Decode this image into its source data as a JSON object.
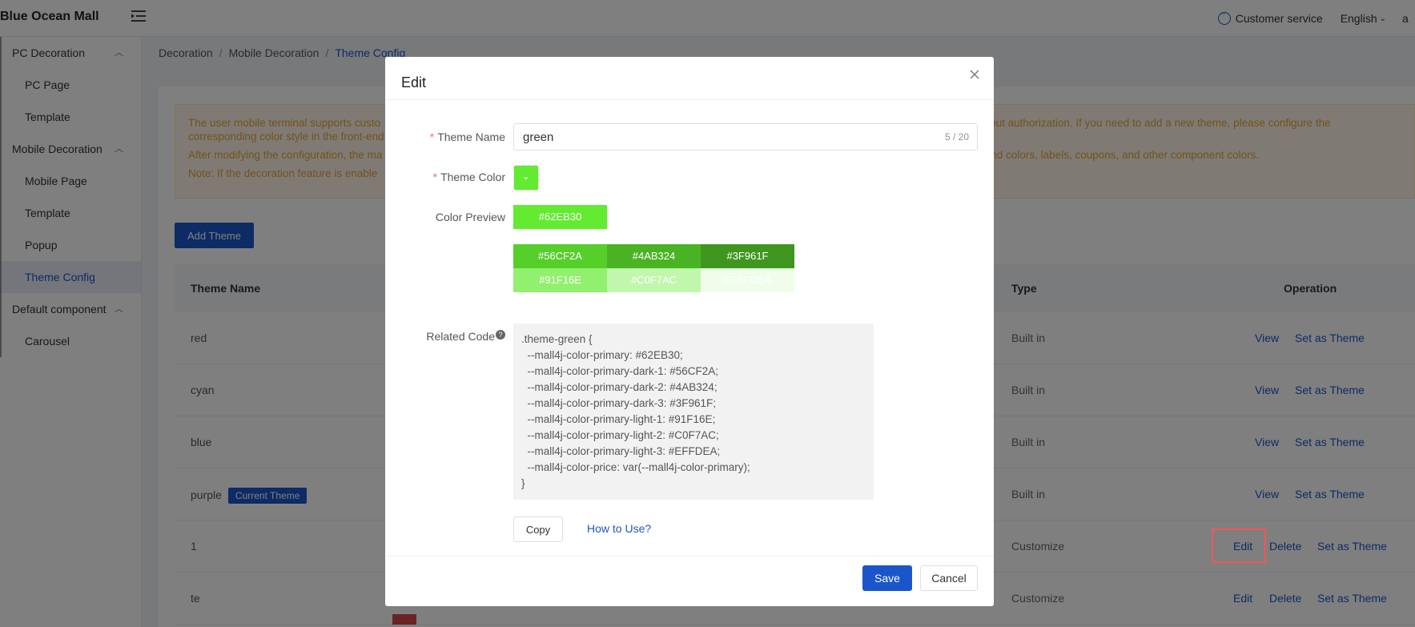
{
  "header": {
    "brand": "Blue Ocean Mall",
    "customer_service": "Customer service",
    "language": "English",
    "user_initial": "a"
  },
  "sidebar": {
    "groups": [
      {
        "label": "PC Decoration",
        "items": [
          {
            "label": "PC Page"
          },
          {
            "label": "Template"
          }
        ]
      },
      {
        "label": "Mobile Decoration",
        "items": [
          {
            "label": "Mobile Page"
          },
          {
            "label": "Template"
          },
          {
            "label": "Popup"
          },
          {
            "label": "Theme Config"
          }
        ]
      },
      {
        "label": "Default component",
        "items": [
          {
            "label": "Carousel"
          }
        ]
      }
    ]
  },
  "breadcrumb": [
    "Decoration",
    "Mobile Decoration",
    "Theme Config"
  ],
  "notice": {
    "line1a": "The user mobile terminal supports custo",
    "line1b": "out authorization. If you need to add a new theme, please configure the",
    "line2": "corresponding color style in the front-end",
    "line3a": "After modifying the configuration, the ma",
    "line3b": "nd colors, labels, coupons, and other component colors.",
    "line4": "Note: If the decoration feature is enable"
  },
  "add_theme_label": "Add Theme",
  "table": {
    "headers": {
      "name": "Theme Name",
      "type": "Type",
      "operation": "Operation"
    },
    "rows": [
      {
        "name": "red",
        "type": "Built in",
        "ops": [
          "View",
          "Set as Theme"
        ]
      },
      {
        "name": "cyan",
        "type": "Built in",
        "ops": [
          "View",
          "Set as Theme"
        ]
      },
      {
        "name": "blue",
        "type": "Built in",
        "ops": [
          "View",
          "Set as Theme"
        ]
      },
      {
        "name": "purple",
        "badge": "Current Theme",
        "type": "Built in",
        "ops": [
          "View",
          "Set as Theme"
        ]
      },
      {
        "name": "1",
        "type": "Customize",
        "ops": [
          "Edit",
          "Delete",
          "Set as Theme"
        ]
      },
      {
        "name": "te",
        "type": "Customize",
        "ops": [
          "Edit",
          "Delete",
          "Set as Theme"
        ]
      }
    ]
  },
  "modal": {
    "title": "Edit",
    "theme_name_label": "Theme Name",
    "theme_name_value": "green",
    "theme_name_count": "5 / 20",
    "theme_color_label": "Theme Color",
    "theme_color": "#62EB30",
    "color_preview_label": "Color Preview",
    "preview_main": "#62EB30",
    "palette": [
      {
        "label": "#56CF2A",
        "color": "#56CF2A"
      },
      {
        "label": "#4AB324",
        "color": "#4AB324"
      },
      {
        "label": "#3F961F",
        "color": "#3F961F"
      },
      {
        "label": "#91F16E",
        "color": "#91F16E"
      },
      {
        "label": "#C0F7AC",
        "color": "#C0F7AC"
      },
      {
        "label": "#EFFDEA",
        "color": "#EFFDEA"
      }
    ],
    "related_code_label": "Related Code",
    "code_lines": [
      ".theme-green {",
      "  --mall4j-color-primary: #62EB30;",
      "  --mall4j-color-primary-dark-1: #56CF2A;",
      "  --mall4j-color-primary-dark-2: #4AB324;",
      "  --mall4j-color-primary-dark-3: #3F961F;",
      "  --mall4j-color-primary-light-1: #91F16E;",
      "  --mall4j-color-primary-light-2: #C0F7AC;",
      "  --mall4j-color-primary-light-3: #EFFDEA;",
      "  --mall4j-color-price: var(--mall4j-color-primary);",
      "}"
    ],
    "copy_label": "Copy",
    "how_to_label": "How to Use?",
    "save_label": "Save",
    "cancel_label": "Cancel"
  },
  "colors": {
    "accent": "#1a56c9",
    "brand_green": "#62EB30",
    "highlight": "#f25757"
  }
}
